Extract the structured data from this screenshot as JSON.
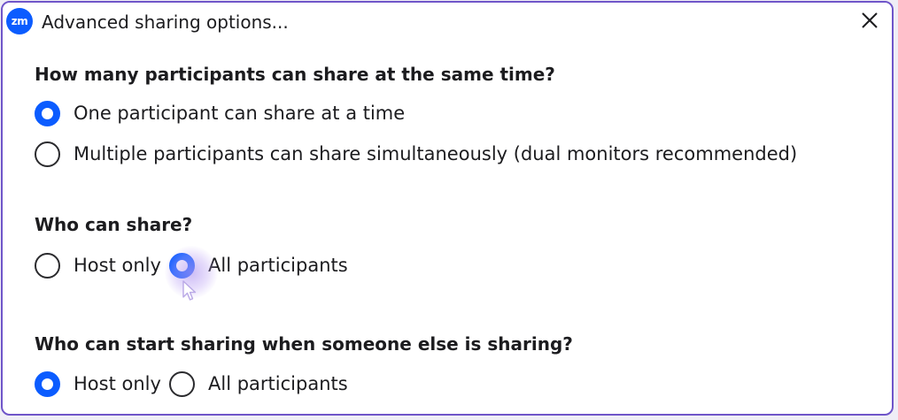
{
  "window": {
    "title": "Advanced sharing options...",
    "app_icon_text": "zm",
    "close_symbol": "×"
  },
  "sections": [
    {
      "heading": "How many participants can share at the same time?",
      "options": [
        {
          "label": "One participant can share at a time",
          "checked": true
        },
        {
          "label": "Multiple participants can share simultaneously (dual monitors recommended)",
          "checked": false
        }
      ]
    },
    {
      "heading": "Who can share?",
      "options": [
        {
          "label": "Host only",
          "checked": false
        },
        {
          "label": "All participants",
          "checked": true
        }
      ]
    },
    {
      "heading": "Who can start sharing when someone else is sharing?",
      "options": [
        {
          "label": "Host only",
          "checked": true
        },
        {
          "label": "All participants",
          "checked": false
        }
      ]
    }
  ],
  "colors": {
    "accent": "#0b5cff",
    "window_border": "#6f55c9",
    "cursor_glow": "#b096f0"
  },
  "icons": {
    "app": "zoom-logo-icon",
    "close": "close-icon",
    "cursor": "mouse-pointer-icon"
  }
}
